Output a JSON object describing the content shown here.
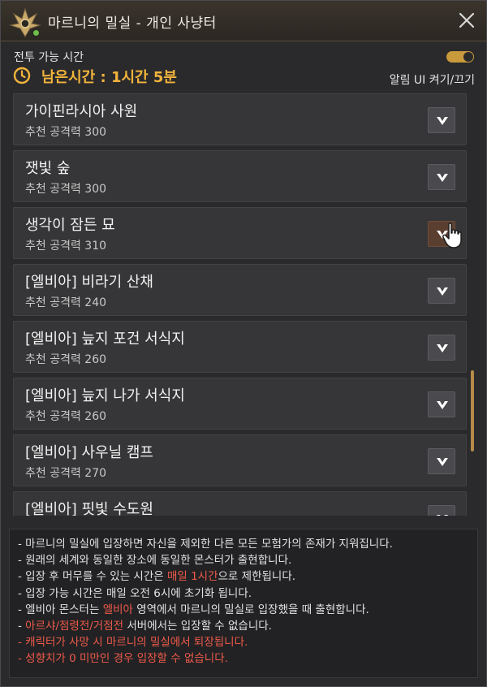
{
  "window": {
    "title": "마르니의 밀실 - 개인 사냥터"
  },
  "header": {
    "combat_label": "전투 가능 시간",
    "remaining_time": "남은시간 : 1시간 5분",
    "alarm_toggle_label": "알림 UI 켜기/끄기",
    "alarm_toggle_on": true
  },
  "dungeons": [
    {
      "name": "가이핀라시아 사원",
      "recommended": "추천 공격력 300"
    },
    {
      "name": "잿빛 숲",
      "recommended": "추천 공격력 300"
    },
    {
      "name": "생각이 잠든 묘",
      "recommended": "추천 공격력 310"
    },
    {
      "name": "[엘비아] 비라기 산채",
      "recommended": "추천 공격력 240"
    },
    {
      "name": "[엘비아] 늪지 포건 서식지",
      "recommended": "추천 공격력 260"
    },
    {
      "name": "[엘비아] 늪지 나가 서식지",
      "recommended": "추천 공격력 260"
    },
    {
      "name": "[엘비아] 사우닐 캠프",
      "recommended": "추천 공격력 270"
    },
    {
      "name": "[엘비아] 핏빛 수도원",
      "recommended": ""
    }
  ],
  "notes": {
    "line1": "- 마르니의 밀실에 입장하면 자신을 제외한 다른 모든 모험가의 존재가 지워집니다.",
    "line2": "- 원래의 세계와 동일한 장소에 동일한 몬스터가 출현합니다.",
    "line3_a": "- 입장 후 머무를 수 있는 시간은 ",
    "line3_hl": "매일 1시간",
    "line3_b": "으로 제한됩니다.",
    "line4": "- 입장 가능 시간은 매일 오전 6시에 초기화 됩니다.",
    "line5_a": "- 엘비아 몬스터는 ",
    "line5_hl": "엘비아",
    "line5_b": " 영역에서 마르니의 밀실로 입장했을 때 출현합니다.",
    "line6_a": "- ",
    "line6_hl": "아르샤/점령전/거점전",
    "line6_b": " 서버에서는 입장할 수 없습니다.",
    "line7": "- 캐릭터가 사망 시 마르니의 밀실에서 퇴장됩니다.",
    "line8": "- 성향치가 0 미만인 경우 입장할 수 없습니다."
  },
  "colors": {
    "accent_gold": "#f2b43c",
    "warning_red": "#ef5a4a",
    "status_green": "#6cc04a"
  },
  "icons": {
    "logo": "marni-emblem-icon",
    "close": "close-icon",
    "clock": "clock-icon",
    "expand": "chevron-down-icon",
    "cursor": "hand-pointer-icon"
  }
}
